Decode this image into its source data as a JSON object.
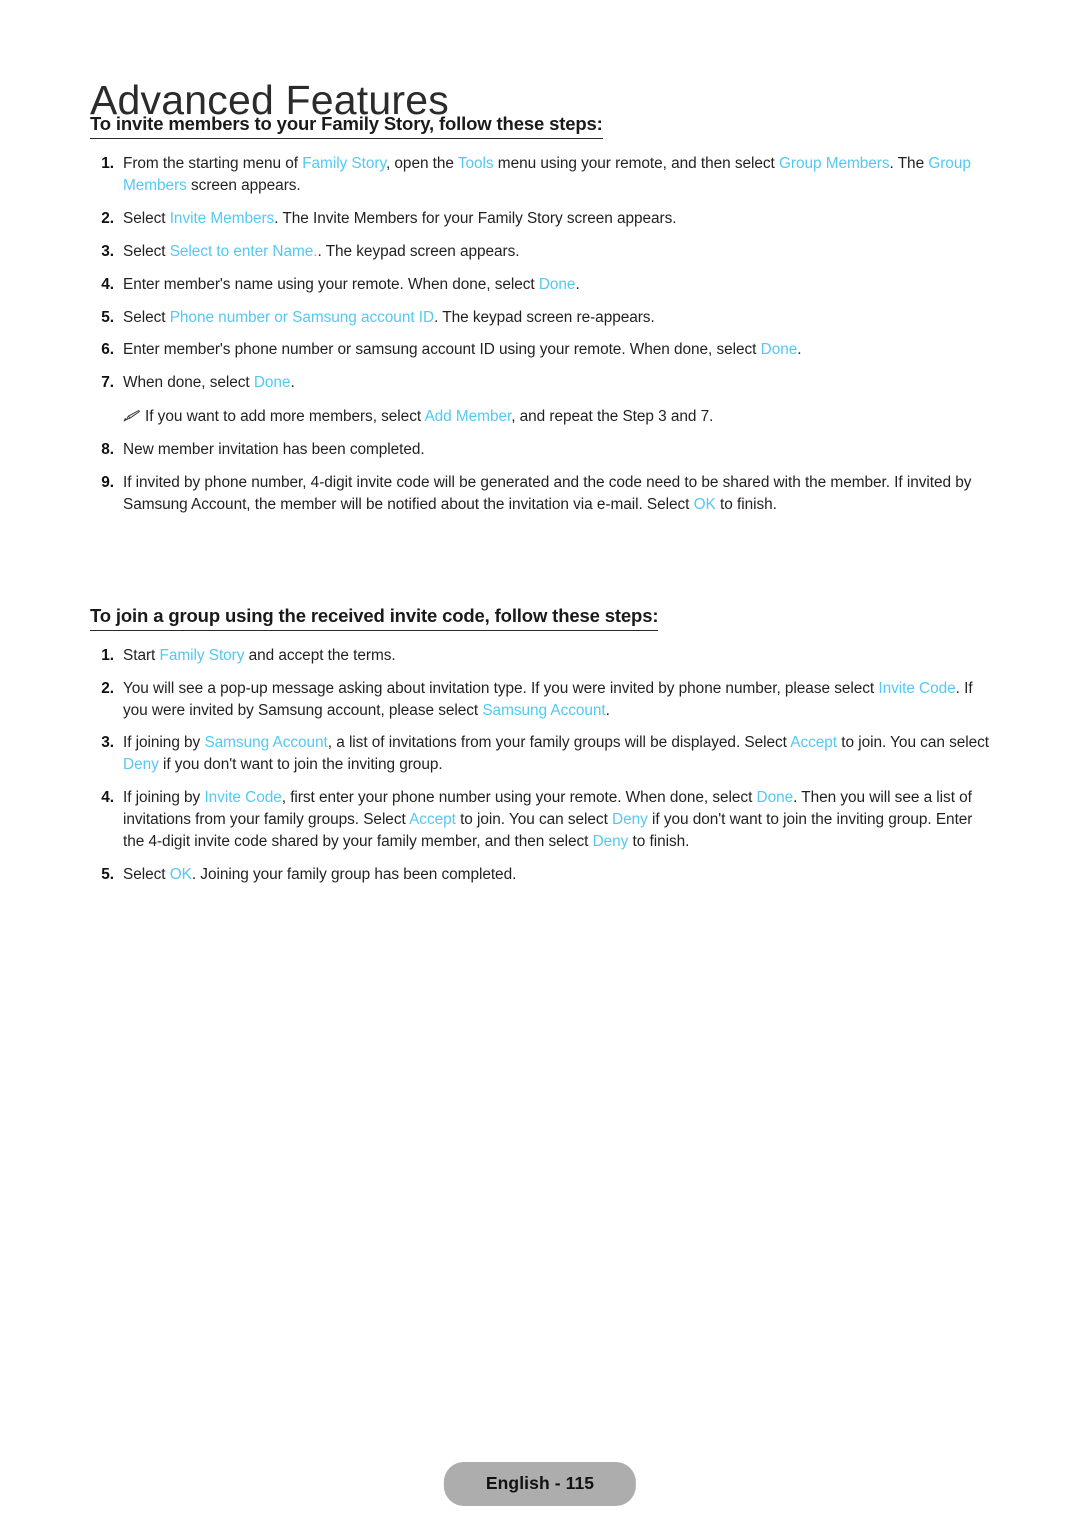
{
  "document": {
    "chapter_title": "Advanced Features",
    "footer_label": "English - 115",
    "accent_color": "#53c9f2",
    "text_color": "#231f20",
    "footer_pill_color": "#adadad"
  },
  "sections": [
    {
      "heading": "To invite members to your Family Story, follow these steps:",
      "steps": [
        {
          "number": "1.",
          "parts": [
            {
              "t": "From the starting menu of ",
              "ui": false
            },
            {
              "t": "Family Story",
              "ui": true
            },
            {
              "t": ", open the ",
              "ui": false
            },
            {
              "t": "Tools",
              "ui": true
            },
            {
              "t": " menu using your remote, and then select ",
              "ui": false
            },
            {
              "t": "Group Members",
              "ui": true
            },
            {
              "t": ". The ",
              "ui": false
            },
            {
              "t": "Group Members",
              "ui": true
            },
            {
              "t": " screen appears.",
              "ui": false
            }
          ]
        },
        {
          "number": "2.",
          "parts": [
            {
              "t": "Select ",
              "ui": false
            },
            {
              "t": "Invite Members",
              "ui": true
            },
            {
              "t": ". The Invite Members for your Family Story screen appears.",
              "ui": false
            }
          ]
        },
        {
          "number": "3.",
          "parts": [
            {
              "t": "Select ",
              "ui": false
            },
            {
              "t": "Select to enter Name.",
              "ui": true
            },
            {
              "t": ". The keypad screen appears.",
              "ui": false
            }
          ]
        },
        {
          "number": "4.",
          "parts": [
            {
              "t": "Enter member's name using your remote. When done, select ",
              "ui": false
            },
            {
              "t": "Done",
              "ui": true
            },
            {
              "t": ".",
              "ui": false
            }
          ]
        },
        {
          "number": "5.",
          "parts": [
            {
              "t": "Select ",
              "ui": false
            },
            {
              "t": "Phone number or Samsung account ID",
              "ui": true
            },
            {
              "t": ". The keypad screen re-appears.",
              "ui": false
            }
          ]
        },
        {
          "number": "6.",
          "parts": [
            {
              "t": "Enter member's phone number or samsung account ID using your remote. When done, select ",
              "ui": false
            },
            {
              "t": "Done",
              "ui": true
            },
            {
              "t": ".",
              "ui": false
            }
          ]
        },
        {
          "number": "7.",
          "parts": [
            {
              "t": "When done, select ",
              "ui": false
            },
            {
              "t": "Done",
              "ui": true
            },
            {
              "t": ".",
              "ui": false
            }
          ]
        }
      ],
      "note": {
        "icon": "pencil-icon",
        "parts": [
          {
            "t": "If you want to add more members, select ",
            "ui": false
          },
          {
            "t": "Add Member",
            "ui": true
          },
          {
            "t": ", and repeat the Step 3 and 7.",
            "ui": false
          }
        ]
      },
      "steps_after_note": [
        {
          "number": "8.",
          "parts": [
            {
              "t": "New member invitation has been completed.",
              "ui": false
            }
          ]
        },
        {
          "number": "9.",
          "parts": [
            {
              "t": "If invited by phone number, 4-digit invite code will be generated and the code need to be shared with the member. If invited by Samsung Account, the member will be notified about the invitation via e-mail. Select ",
              "ui": false
            },
            {
              "t": "OK",
              "ui": true
            },
            {
              "t": " to finish.",
              "ui": false
            }
          ]
        }
      ]
    },
    {
      "heading": "To join a group using the received invite code, follow these steps:",
      "steps": [
        {
          "number": "1.",
          "parts": [
            {
              "t": "Start ",
              "ui": false
            },
            {
              "t": "Family Story",
              "ui": true
            },
            {
              "t": " and accept the terms.",
              "ui": false
            }
          ]
        },
        {
          "number": "2.",
          "parts": [
            {
              "t": "You will see a pop-up message asking about invitation type. If you were invited by phone number, please select ",
              "ui": false
            },
            {
              "t": "Invite Code",
              "ui": true
            },
            {
              "t": ". If you were invited by Samsung account, please select ",
              "ui": false
            },
            {
              "t": "Samsung Account",
              "ui": true
            },
            {
              "t": ".",
              "ui": false
            }
          ]
        },
        {
          "number": "3.",
          "parts": [
            {
              "t": "If joining by ",
              "ui": false
            },
            {
              "t": "Samsung Account",
              "ui": true
            },
            {
              "t": ", a list of invitations from your family groups will be displayed. Select ",
              "ui": false
            },
            {
              "t": "Accept",
              "ui": true
            },
            {
              "t": " to join. You can select ",
              "ui": false
            },
            {
              "t": "Deny",
              "ui": true
            },
            {
              "t": " if you don't want to join the inviting group.",
              "ui": false
            }
          ]
        },
        {
          "number": "4.",
          "parts": [
            {
              "t": "If joining by ",
              "ui": false
            },
            {
              "t": "Invite Code",
              "ui": true
            },
            {
              "t": ", first enter your phone number using your remote. When done, select ",
              "ui": false
            },
            {
              "t": "Done",
              "ui": true
            },
            {
              "t": ". Then you will see a list of invitations from your family groups. Select ",
              "ui": false
            },
            {
              "t": "Accept",
              "ui": true
            },
            {
              "t": " to join. You can select ",
              "ui": false
            },
            {
              "t": "Deny",
              "ui": true
            },
            {
              "t": " if you don't want to join the inviting group. Enter the 4-digit invite code shared by your family member, and then select ",
              "ui": false
            },
            {
              "t": "Deny",
              "ui": true
            },
            {
              "t": " to finish.",
              "ui": false
            }
          ]
        },
        {
          "number": "5.",
          "parts": [
            {
              "t": "Select ",
              "ui": false
            },
            {
              "t": "OK",
              "ui": true
            },
            {
              "t": ". Joining your family group has been completed.",
              "ui": false
            }
          ]
        }
      ],
      "note": null,
      "steps_after_note": []
    }
  ]
}
